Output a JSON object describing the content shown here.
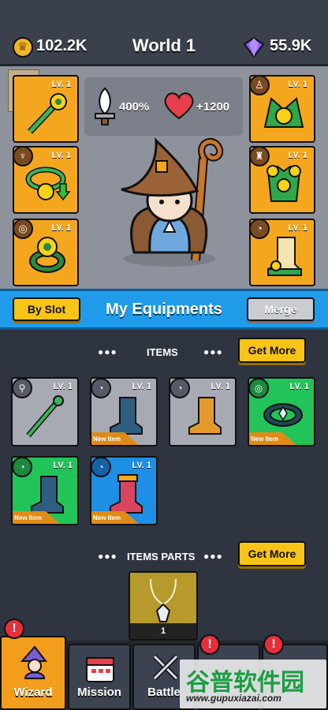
{
  "currency": {
    "coins": "102.2K",
    "gems": "55.9K"
  },
  "world_title": "World 1",
  "stats": {
    "attack": "400%",
    "health": "+1200"
  },
  "equipped_slots": [
    {
      "level": "LV. 1",
      "item": "wand"
    },
    {
      "level": "LV. 1",
      "item": "necklace"
    },
    {
      "level": "LV. 1",
      "item": "ring"
    },
    {
      "level": "LV. 1",
      "item": "hat"
    },
    {
      "level": "LV. 1",
      "item": "armor"
    },
    {
      "level": "LV. 1",
      "item": "boots"
    }
  ],
  "equip_bar": {
    "by_slot": "By Slot",
    "title": "My Equipments",
    "merge": "Merge"
  },
  "items_section": {
    "title": "ITEMS",
    "get_more": "Get More"
  },
  "items": [
    {
      "level": "LV. 1",
      "item": "wand",
      "new": ""
    },
    {
      "level": "LV. 1",
      "item": "boot",
      "new": "New Item"
    },
    {
      "level": "LV. 1",
      "item": "boot",
      "new": ""
    },
    {
      "level": "LV. 1",
      "item": "ring",
      "new": "New Item"
    },
    {
      "level": "LV. 1",
      "item": "boot",
      "new": "New Item"
    },
    {
      "level": "LV. 1",
      "item": "boot",
      "new": "New Item"
    }
  ],
  "parts_section": {
    "title": "ITEMS PARTS",
    "get_more": "Get More",
    "count": "1"
  },
  "nav": {
    "wizard": "Wizard",
    "mission": "Mission",
    "battle": "Battle"
  },
  "watermark": {
    "line1": "谷普软件园",
    "line2": "www.gupuxiazai.com"
  },
  "colors": {
    "gold": "#f4a71e",
    "blue": "#1f9bea",
    "green": "#22c45a"
  }
}
